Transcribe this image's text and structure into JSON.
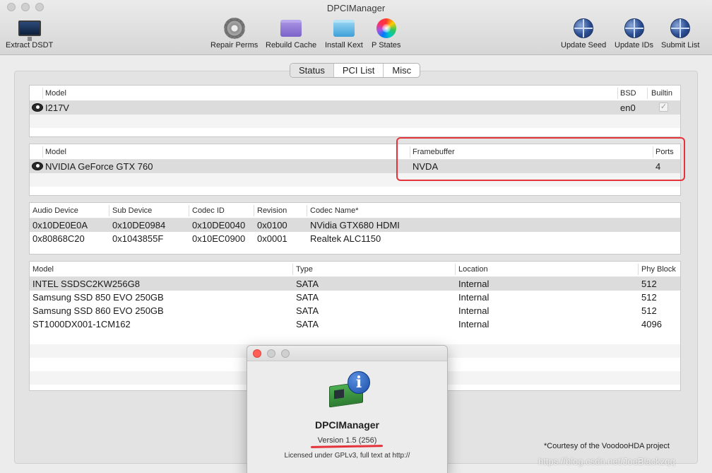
{
  "window": {
    "title": "DPCIManager"
  },
  "toolbar": {
    "extract_dsdt": "Extract DSDT",
    "repair_perms": "Repair Perms",
    "rebuild_cache": "Rebuild Cache",
    "install_kext": "Install Kext",
    "p_states": "P States",
    "update_seed": "Update Seed",
    "update_ids": "Update IDs",
    "submit_list": "Submit List"
  },
  "tabs": [
    {
      "label": "Status",
      "active": true
    },
    {
      "label": "PCI List",
      "active": false
    },
    {
      "label": "Misc",
      "active": false
    }
  ],
  "network": {
    "headers": {
      "model": "Model",
      "bsd": "BSD",
      "builtin": "Builtin"
    },
    "rows": [
      {
        "model": "I217V",
        "bsd": "en0",
        "builtin": "✓"
      }
    ]
  },
  "graphics": {
    "headers": {
      "model": "Model",
      "framebuffer": "Framebuffer",
      "ports": "Ports"
    },
    "rows": [
      {
        "model": "NVIDIA GeForce GTX 760",
        "framebuffer": "NVDA",
        "ports": "4"
      }
    ]
  },
  "audio": {
    "headers": {
      "device": "Audio Device",
      "sub": "Sub Device",
      "codec_id": "Codec ID",
      "revision": "Revision",
      "codec_name": "Codec Name*"
    },
    "rows": [
      {
        "device": "0x10DE0E0A",
        "sub": "0x10DE0984",
        "codec_id": "0x10DE0040",
        "revision": "0x0100",
        "codec_name": "NVidia GTX680 HDMI"
      },
      {
        "device": "0x80868C20",
        "sub": "0x1043855F",
        "codec_id": "0x10EC0900",
        "revision": "0x0001",
        "codec_name": "Realtek ALC1150"
      }
    ]
  },
  "storage": {
    "headers": {
      "model": "Model",
      "type": "Type",
      "location": "Location",
      "phy_block": "Phy Block"
    },
    "rows": [
      {
        "model": "INTEL SSDSC2KW256G8",
        "type": "SATA",
        "location": "Internal",
        "phy_block": "512"
      },
      {
        "model": "Samsung SSD 850 EVO 250GB",
        "type": "SATA",
        "location": "Internal",
        "phy_block": "512"
      },
      {
        "model": "Samsung SSD 860 EVO 250GB",
        "type": "SATA",
        "location": "Internal",
        "phy_block": "512"
      },
      {
        "model": "ST1000DX001-1CM162",
        "type": "SATA",
        "location": "Internal",
        "phy_block": "4096"
      }
    ]
  },
  "courtesy": "*Courtesy of the VoodooHDA project",
  "about": {
    "name": "DPCIManager",
    "version": "Version 1.5 (256)",
    "license": "Licensed under GPLv3, full text at http://"
  },
  "watermark": "https://blog.csdn.net/JoeBlackzqq",
  "colors": {
    "highlight": "#e5333b",
    "close": "#ff5f57"
  }
}
